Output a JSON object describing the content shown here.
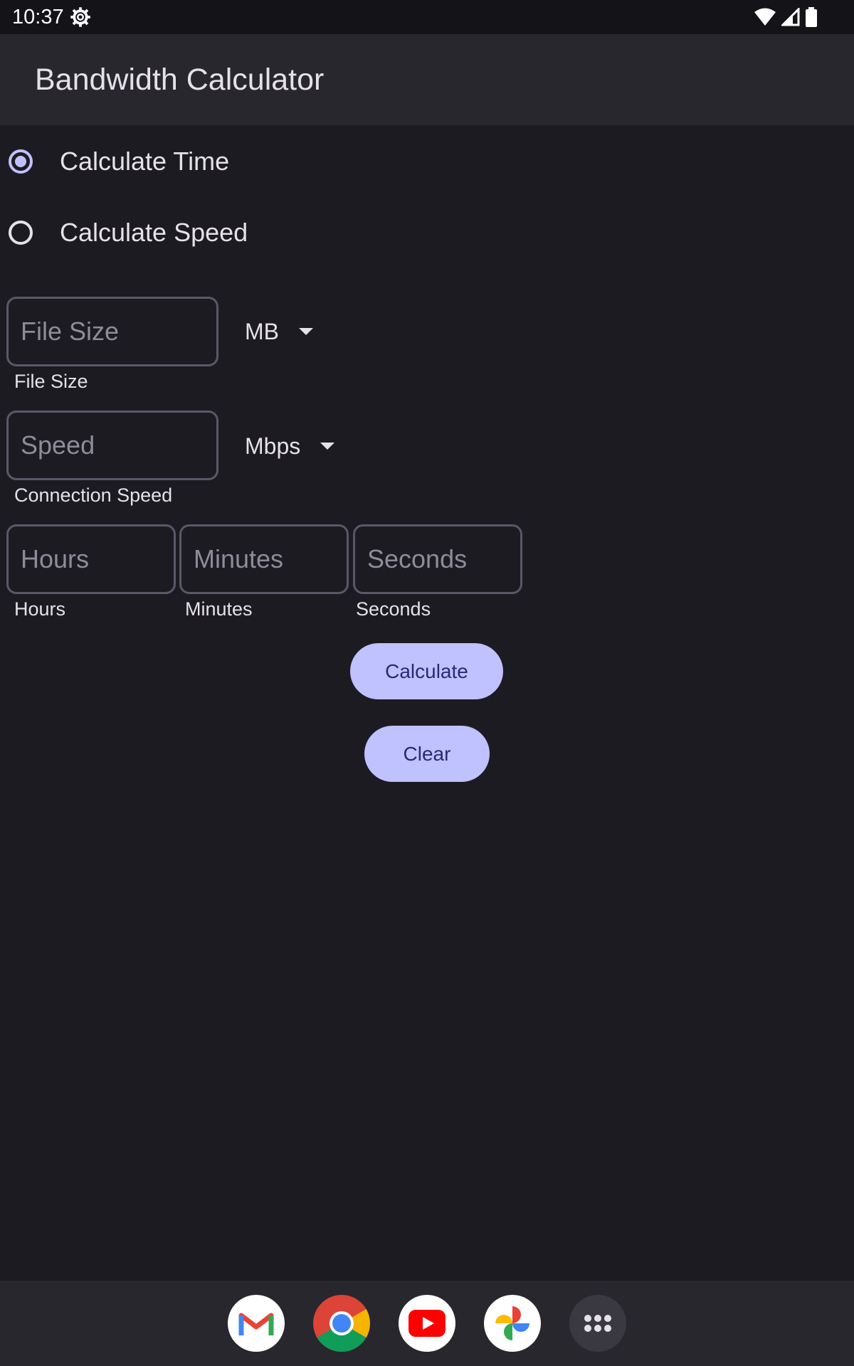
{
  "status_bar": {
    "time": "10:37",
    "icons": [
      "settings-gear-icon",
      "wifi-icon",
      "cellular-signal-icon",
      "battery-icon"
    ]
  },
  "app_bar": {
    "title": "Bandwidth Calculator"
  },
  "mode": {
    "options": [
      {
        "label": "Calculate Time",
        "selected": true
      },
      {
        "label": "Calculate Speed",
        "selected": false
      }
    ]
  },
  "file_size": {
    "placeholder": "File Size",
    "value": "",
    "helper": "File Size",
    "unit": "MB"
  },
  "speed": {
    "placeholder": "Speed",
    "value": "",
    "helper": "Connection Speed",
    "unit": "Mbps"
  },
  "time": {
    "hours": {
      "placeholder": "Hours",
      "value": "",
      "helper": "Hours"
    },
    "minutes": {
      "placeholder": "Minutes",
      "value": "",
      "helper": "Minutes"
    },
    "seconds": {
      "placeholder": "Seconds",
      "value": "",
      "helper": "Seconds"
    }
  },
  "actions": {
    "calculate_label": "Calculate",
    "clear_label": "Clear"
  },
  "dock": [
    "gmail-icon",
    "chrome-icon",
    "youtube-icon",
    "photos-icon",
    "app-drawer-icon"
  ],
  "colors": {
    "accent": "#c0c1ff",
    "background": "#1c1b21",
    "appbar": "#28272e",
    "on_accent": "#29297a"
  }
}
